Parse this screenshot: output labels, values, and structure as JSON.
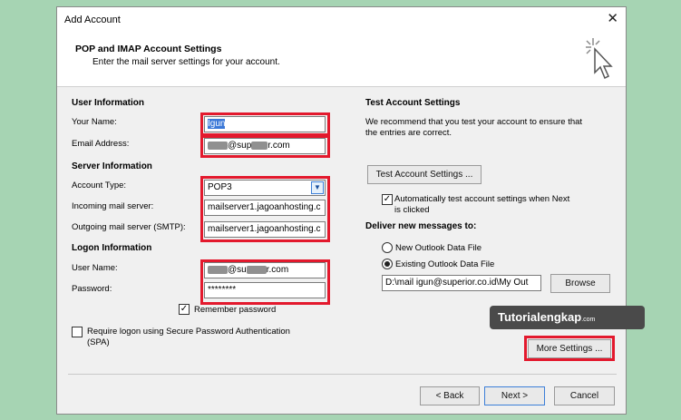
{
  "window": {
    "title": "Add Account",
    "close_glyph": "✕"
  },
  "header": {
    "title": "POP and IMAP Account Settings",
    "subtitle": "Enter the mail server settings for your account."
  },
  "user_info": {
    "heading": "User Information",
    "name_label": "Your Name:",
    "name_value": "Igun",
    "email_label": "Email Address:",
    "email_domain_part1": "@sup",
    "email_domain_part2": "r.com"
  },
  "server_info": {
    "heading": "Server Information",
    "account_type_label": "Account Type:",
    "account_type_value": "POP3",
    "incoming_label": "Incoming mail server:",
    "incoming_value": "mailserver1.jagoanhosting.c",
    "outgoing_label": "Outgoing mail server (SMTP):",
    "outgoing_value": "mailserver1.jagoanhosting.c"
  },
  "logon_info": {
    "heading": "Logon Information",
    "username_label": "User Name:",
    "username_part1": "@su",
    "username_part2": "r.com",
    "password_label": "Password:",
    "password_value": "********",
    "remember_label": "Remember password",
    "spa_label_line1": "Require logon using Secure Password Authentication",
    "spa_label_line2": "(SPA)"
  },
  "test_settings": {
    "heading": "Test Account Settings",
    "desc_line1": "We recommend that you test your account to ensure that",
    "desc_line2": "the entries are correct.",
    "test_button": "Test Account Settings ...",
    "auto_test_line1": "Automatically test account settings when Next",
    "auto_test_line2": "is clicked",
    "deliver_heading": "Deliver new messages to:",
    "new_file_label": "New Outlook Data File",
    "existing_file_label": "Existing Outlook Data File",
    "existing_path": "D:\\mail igun@superior.co.id\\My Out",
    "browse_button": "Browse",
    "more_settings_button": "More Settings ..."
  },
  "footer": {
    "back_button": "< Back",
    "next_button": "Next >",
    "cancel_button": "Cancel"
  },
  "watermark": {
    "brand": "Tutorialengkap",
    "suffix": ".com"
  },
  "colors": {
    "highlight_red": "#e3192d",
    "background_green": "#a6d4b3",
    "dialog_bg": "#f0f0f0"
  }
}
